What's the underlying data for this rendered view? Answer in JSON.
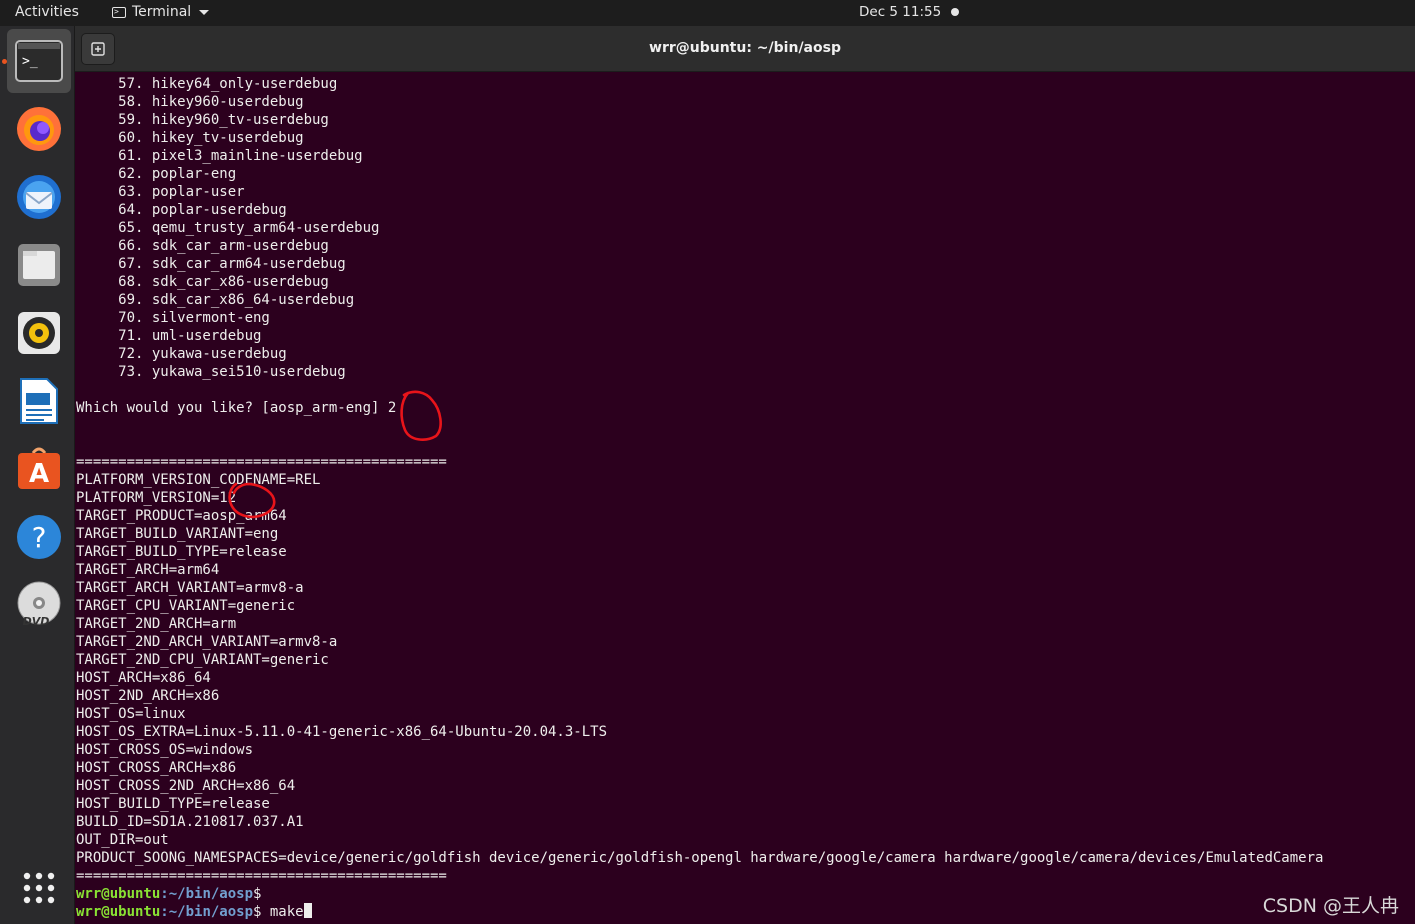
{
  "topbar": {
    "activities": "Activities",
    "app_name": "Terminal",
    "clock": "Dec 5  11:55"
  },
  "dock": {
    "items": [
      "terminal",
      "firefox",
      "thunderbird",
      "files",
      "rhythmbox",
      "libreoffice-writer",
      "ubuntu-software",
      "help",
      "dvd",
      "show-applications"
    ],
    "accent": "#e95420"
  },
  "terminal": {
    "title": "wrr@ubuntu: ~/bin/aosp",
    "lines": [
      "     57. hikey64_only-userdebug",
      "     58. hikey960-userdebug",
      "     59. hikey960_tv-userdebug",
      "     60. hikey_tv-userdebug",
      "     61. pixel3_mainline-userdebug",
      "     62. poplar-eng",
      "     63. poplar-user",
      "     64. poplar-userdebug",
      "     65. qemu_trusty_arm64-userdebug",
      "     66. sdk_car_arm-userdebug",
      "     67. sdk_car_arm64-userdebug",
      "     68. sdk_car_x86-userdebug",
      "     69. sdk_car_x86_64-userdebug",
      "     70. silvermont-eng",
      "     71. uml-userdebug",
      "     72. yukawa-userdebug",
      "     73. yukawa_sei510-userdebug",
      "",
      "Which would you like? [aosp_arm-eng] 2",
      "",
      "",
      "============================================",
      "PLATFORM_VERSION_CODENAME=REL",
      "PLATFORM_VERSION=12",
      "TARGET_PRODUCT=aosp_arm64",
      "TARGET_BUILD_VARIANT=eng",
      "TARGET_BUILD_TYPE=release",
      "TARGET_ARCH=arm64",
      "TARGET_ARCH_VARIANT=armv8-a",
      "TARGET_CPU_VARIANT=generic",
      "TARGET_2ND_ARCH=arm",
      "TARGET_2ND_ARCH_VARIANT=armv8-a",
      "TARGET_2ND_CPU_VARIANT=generic",
      "HOST_ARCH=x86_64",
      "HOST_2ND_ARCH=x86",
      "HOST_OS=linux",
      "HOST_OS_EXTRA=Linux-5.11.0-41-generic-x86_64-Ubuntu-20.04.3-LTS",
      "HOST_CROSS_OS=windows",
      "HOST_CROSS_ARCH=x86",
      "HOST_CROSS_2ND_ARCH=x86_64",
      "HOST_BUILD_TYPE=release",
      "BUILD_ID=SD1A.210817.037.A1",
      "OUT_DIR=out",
      "PRODUCT_SOONG_NAMESPACES=device/generic/goldfish device/generic/goldfish-opengl hardware/google/camera hardware/google/camera/devices/EmulatedCamera",
      "============================================"
    ],
    "prompts": [
      {
        "user": "wrr@ubuntu",
        "path": ":~/bin/aosp",
        "symbol": "$",
        "command": ""
      },
      {
        "user": "wrr@ubuntu",
        "path": ":~/bin/aosp",
        "symbol": "$",
        "command": " make"
      }
    ]
  },
  "annotation_color": "#e8141a",
  "watermark": "CSDN @王人冉"
}
